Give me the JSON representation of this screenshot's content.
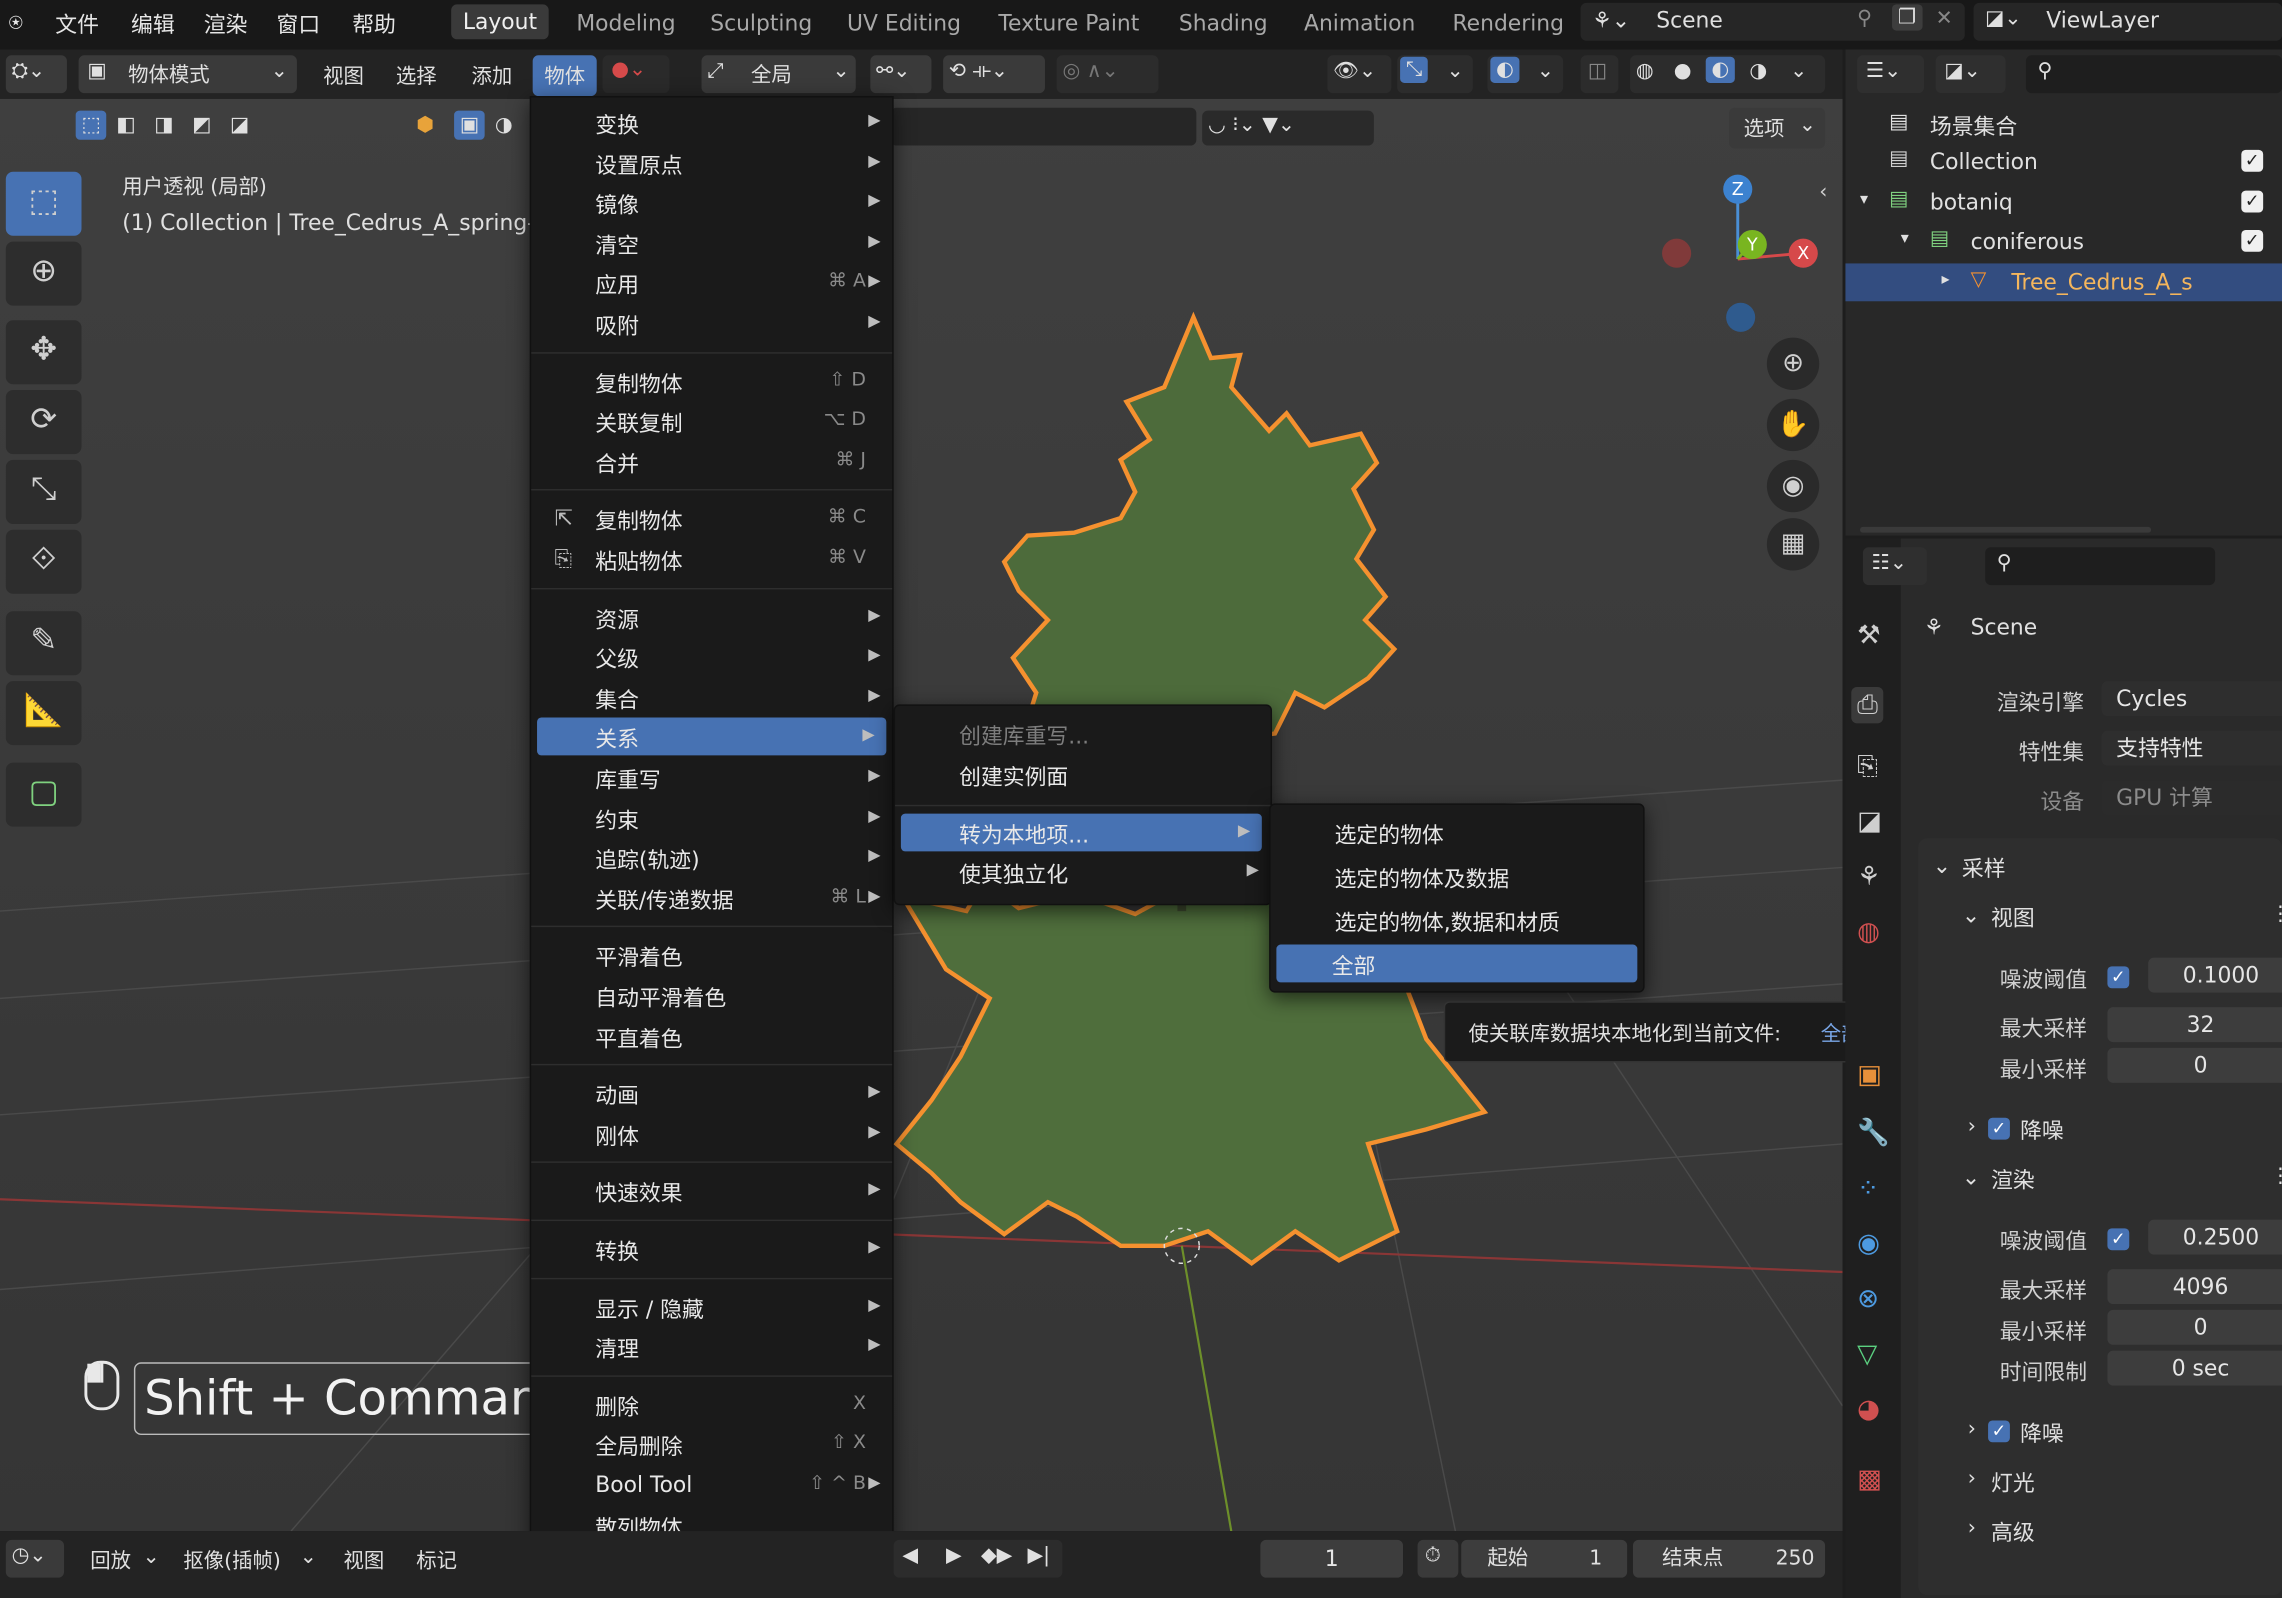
{
  "topbar": {
    "menus": [
      "文件",
      "编辑",
      "渲染",
      "窗口",
      "帮助"
    ],
    "workspaces": [
      "Layout",
      "Modeling",
      "Sculpting",
      "UV Editing",
      "Texture Paint",
      "Shading",
      "Animation",
      "Rendering"
    ],
    "scene": "Scene",
    "view_layer": "ViewLayer"
  },
  "viewport_header": {
    "mode": "物体模式",
    "menus": [
      "视图",
      "选择",
      "添加",
      "物体"
    ],
    "transform_orientation": "全局",
    "options": "选项"
  },
  "overlay": {
    "view_name": "用户透视 (局部)",
    "collection_line": "(1) Collection | Tree_Cedrus_A_spring-",
    "shortcut": "Shift + Commar"
  },
  "navigation_gizmo": {
    "x": "X",
    "y": "Y",
    "z": "Z"
  },
  "object_menu": {
    "groups": [
      [
        {
          "label": "变换",
          "sub": true
        },
        {
          "label": "设置原点",
          "sub": true
        },
        {
          "label": "镜像",
          "sub": true
        },
        {
          "label": "清空",
          "sub": true
        },
        {
          "label": "应用",
          "shortcut": "⌘ A",
          "sub": true
        },
        {
          "label": "吸附",
          "sub": true
        }
      ],
      [
        {
          "label": "复制物体",
          "shortcut": "⇧ D"
        },
        {
          "label": "关联复制",
          "shortcut": "⌥ D"
        },
        {
          "label": "合并",
          "shortcut": "⌘ J"
        }
      ],
      [
        {
          "label": "复制物体",
          "shortcut": "⌘ C"
        },
        {
          "label": "粘贴物体",
          "shortcut": "⌘ V"
        }
      ],
      [
        {
          "label": "资源",
          "sub": true
        },
        {
          "label": "父级",
          "sub": true
        },
        {
          "label": "集合",
          "sub": true
        },
        {
          "label": "关系",
          "sub": true,
          "highlight": true
        },
        {
          "label": "库重写",
          "sub": true
        },
        {
          "label": "约束",
          "sub": true
        },
        {
          "label": "追踪(轨迹)",
          "sub": true
        },
        {
          "label": "关联/传递数据",
          "shortcut": "⌘ L",
          "sub": true
        }
      ],
      [
        {
          "label": "平滑着色"
        },
        {
          "label": "自动平滑着色"
        },
        {
          "label": "平直着色"
        }
      ],
      [
        {
          "label": "动画",
          "sub": true
        },
        {
          "label": "刚体",
          "sub": true
        }
      ],
      [
        {
          "label": "快速效果",
          "sub": true
        }
      ],
      [
        {
          "label": "转换",
          "sub": true
        }
      ],
      [
        {
          "label": "显示 / 隐藏",
          "sub": true
        },
        {
          "label": "清理",
          "sub": true
        }
      ],
      [
        {
          "label": "删除",
          "shortcut": "X"
        },
        {
          "label": "全局删除",
          "shortcut": "⇧ X"
        },
        {
          "label": "Bool Tool",
          "shortcut": "⇧ ^ B",
          "sub": true
        },
        {
          "label": "散列物体"
        }
      ]
    ]
  },
  "relations_menu": {
    "items": [
      "创建库重写...",
      "创建实例面"
    ],
    "items2": [
      "转为本地项...",
      "使其独立化"
    ]
  },
  "make_local_menu": {
    "items": [
      "选定的物体",
      "选定的物体及数据",
      "选定的物体,数据和材质",
      "全部"
    ]
  },
  "tooltip": {
    "text": "使关联库数据块本地化到当前文件:",
    "value": "全部"
  },
  "timeline": {
    "menus": [
      "回放",
      "抠像(插帧)",
      "视图",
      "标记"
    ],
    "current_frame": "1",
    "start_label": "起始",
    "start": "1",
    "end_label": "结束点",
    "end": "250"
  },
  "outliner": {
    "root": "场景集合",
    "items": [
      {
        "label": "Collection",
        "indent": 0
      },
      {
        "label": "botaniq",
        "indent": 0
      },
      {
        "label": "coniferous",
        "indent": 1
      },
      {
        "label": "Tree_Cedrus_A_s",
        "indent": 2,
        "selected": true
      }
    ]
  },
  "properties": {
    "scene": "Scene",
    "render_engine_label": "渲染引擎",
    "render_engine": "Cycles",
    "feature_set_label": "特性集",
    "feature_set": "支持特性",
    "device_label": "设备",
    "device": "GPU 计算",
    "sampling": "采样",
    "viewport_section": "视图",
    "noise_threshold_label": "噪波阈值",
    "viewport_noise": "0.1000",
    "max_samples_label": "最大采样",
    "viewport_max": "32",
    "min_samples_label": "最小采样",
    "viewport_min": "0",
    "denoise_label": "降噪",
    "render_section": "渲染",
    "render_noise": "0.2500",
    "render_max": "4096",
    "render_min": "0",
    "time_limit_label": "时间限制",
    "time_limit": "0 sec",
    "lights": "灯光",
    "advanced": "高级"
  },
  "colors": {
    "accent": "#4772b3",
    "outline": "#f5912f",
    "panel": "#2a2a2a"
  }
}
